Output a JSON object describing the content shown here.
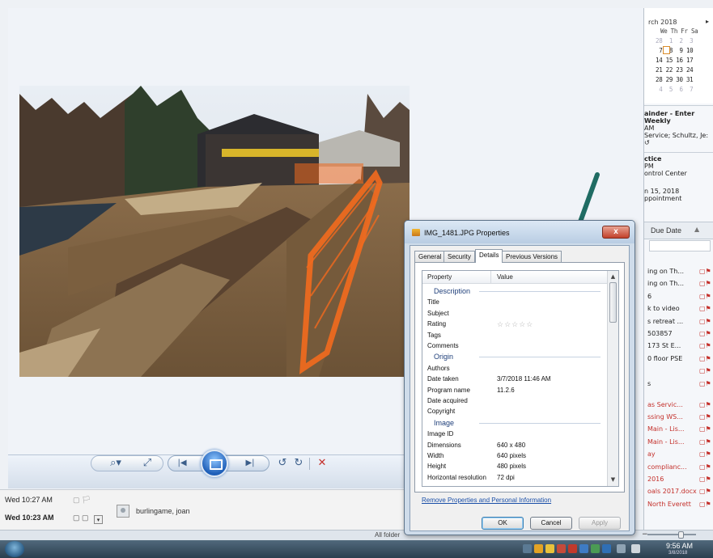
{
  "dialog": {
    "title": "IMG_1481.JPG Properties",
    "close_glyph": "x",
    "tabs": [
      {
        "label": "General"
      },
      {
        "label": "Security"
      },
      {
        "label": "Details"
      },
      {
        "label": "Previous Versions"
      }
    ],
    "active_tab": "Details",
    "columns": {
      "property": "Property",
      "value": "Value"
    },
    "sections": {
      "description": {
        "label": "Description",
        "rows": [
          {
            "key": "Title",
            "value": ""
          },
          {
            "key": "Subject",
            "value": ""
          },
          {
            "key": "Rating",
            "value": "☆☆☆☆☆"
          },
          {
            "key": "Tags",
            "value": ""
          },
          {
            "key": "Comments",
            "value": ""
          }
        ]
      },
      "origin": {
        "label": "Origin",
        "rows": [
          {
            "key": "Authors",
            "value": ""
          },
          {
            "key": "Date taken",
            "value": "3/7/2018 11:46 AM"
          },
          {
            "key": "Program name",
            "value": "11.2.6"
          },
          {
            "key": "Date acquired",
            "value": ""
          },
          {
            "key": "Copyright",
            "value": ""
          }
        ]
      },
      "image": {
        "label": "Image",
        "rows": [
          {
            "key": "Image ID",
            "value": ""
          },
          {
            "key": "Dimensions",
            "value": "640 x 480"
          },
          {
            "key": "Width",
            "value": "640 pixels"
          },
          {
            "key": "Height",
            "value": "480 pixels"
          },
          {
            "key": "Horizontal resolution",
            "value": "72 dpi"
          }
        ]
      }
    },
    "remove_link": "Remove Properties and Personal Information",
    "buttons": {
      "ok": "OK",
      "cancel": "Cancel",
      "apply": "Apply"
    }
  },
  "viewer": {
    "toolbar": {
      "zoom_icon": "⌕▾",
      "fit_icon": "⤢",
      "prev_icon": "|◀",
      "next_icon": "▶|",
      "rotate_ccw_icon": "↺",
      "rotate_cw_icon": "↻",
      "delete_icon": "✕"
    }
  },
  "email_list": {
    "rows": [
      {
        "time": "Wed 10:27 AM",
        "flags": "▢ 🏳"
      },
      {
        "time": "Wed 10:23 AM",
        "flags": "▢ ▢"
      }
    ],
    "dropdown_glyph": "▾",
    "sender": "burlingame, joan"
  },
  "statusbar": {
    "text": "All folder",
    "zoom_minus": "−"
  },
  "todo_pane": {
    "calendar": {
      "month": "rch 2018",
      "next_glyph": "▸",
      "header": "We Th Fr Sa",
      "weeks": [
        "28  1  2  3",
        " 7  8  9 10",
        "14 15 16 17",
        "21 22 23 24",
        "28 29 30 31",
        " 4  5  6  7"
      ]
    },
    "appointments": [
      {
        "line1": "ainder - Enter Weekly",
        "line2": "AM",
        "line3": "Service; Schultz, Je: ↺"
      },
      {
        "line1": "ctice",
        "line2": "PM",
        "line3": "ontrol Center"
      },
      {
        "line1": "n 15, 2018",
        "line2": "ppointment",
        "line3": ""
      }
    ],
    "todo_header": "Due Date",
    "sort_glyph": "▲",
    "tasks": [
      {
        "text": "ing on Th...",
        "red": false
      },
      {
        "text": "ing on Th...",
        "red": false
      },
      {
        "text": "6",
        "red": false
      },
      {
        "text": "k to video",
        "red": false
      },
      {
        "text": "s retreat ...",
        "red": false
      },
      {
        "text": "503857",
        "red": false
      },
      {
        "text": "173 St E...",
        "red": false
      },
      {
        "text": "0 floor PSE",
        "red": false
      },
      {
        "text": "",
        "red": false
      },
      {
        "text": "s",
        "red": false
      },
      {
        "text": "as Servic...",
        "red": true
      },
      {
        "text": "ssing WS...",
        "red": true
      },
      {
        "text": "Main - Lis...",
        "red": true
      },
      {
        "text": "Main - Lis...",
        "red": true
      },
      {
        "text": "ay",
        "red": true
      },
      {
        "text": "complianc...",
        "red": true
      },
      {
        "text": "2016",
        "red": true
      },
      {
        "text": "oals 2017.docx",
        "red": true
      },
      {
        "text": "North Everett",
        "red": true
      }
    ]
  },
  "taskbar": {
    "time": "9:56 AM",
    "date": "3/8/2018"
  }
}
